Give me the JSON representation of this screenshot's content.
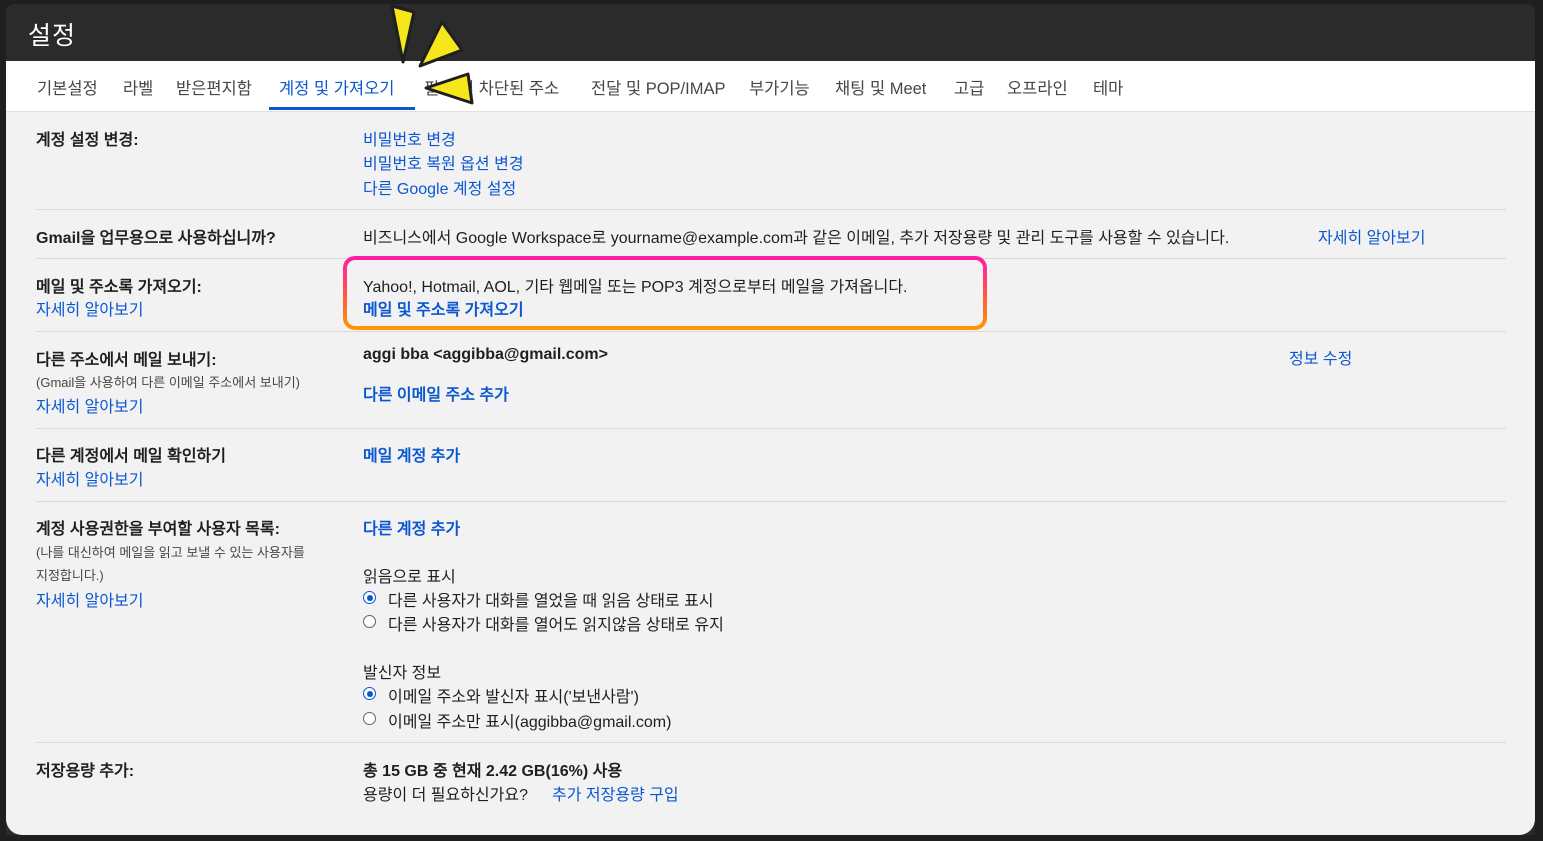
{
  "title": "설정",
  "tabs": [
    {
      "label": "기본설정"
    },
    {
      "label": "라벨"
    },
    {
      "label": "받은편지함"
    },
    {
      "label": "계정 및 가져오기",
      "active": true
    },
    {
      "label": "필터 및 차단된 주소"
    },
    {
      "label": "전달 및 POP/IMAP"
    },
    {
      "label": "부가기능"
    },
    {
      "label": "채팅 및 Meet"
    },
    {
      "label": "고급"
    },
    {
      "label": "오프라인"
    },
    {
      "label": "테마"
    }
  ],
  "sections": {
    "account_change": {
      "label": "계정 설정 변경:",
      "links": [
        "비밀번호 변경",
        "비밀번호 복원 옵션 변경",
        "다른 Google 계정 설정"
      ]
    },
    "business": {
      "label": "Gmail을 업무용으로 사용하십니까?",
      "text": "비즈니스에서 Google Workspace로 yourname@example.com과 같은 이메일, 추가 저장용량 및 관리 도구를 사용할 수 있습니다.",
      "link": "자세히 알아보기"
    },
    "import": {
      "label": "메일 및 주소록 가져오기:",
      "learn_more": "자세히 알아보기",
      "text": "Yahoo!, Hotmail, AOL, 기타 웹메일 또는 POP3 계정으로부터 메일을 가져옵니다.",
      "action": "메일 및 주소록 가져오기"
    },
    "send_as": {
      "label": "다른 주소에서 메일 보내기:",
      "sub": "(Gmail을 사용하여 다른 이메일 주소에서 보내기)",
      "learn_more": "자세히 알아보기",
      "address": "aggi bba <aggibba@gmail.com>",
      "edit": "정보 수정",
      "add": "다른 이메일 주소 추가"
    },
    "check_mail": {
      "label": "다른 계정에서 메일 확인하기",
      "learn_more": "자세히 알아보기",
      "add": "메일 계정 추가"
    },
    "delegate": {
      "label": "계정 사용권한을 부여할 사용자 목록:",
      "sub_line1": "(나를 대신하여 메일을 읽고 보낼 수 있는 사용자를",
      "sub_line2": "지정합니다.)",
      "learn_more": "자세히 알아보기",
      "add": "다른 계정 추가",
      "read_title": "읽음으로 표시",
      "read_options": [
        {
          "label": "다른 사용자가 대화를 열었을 때 읽음 상태로 표시",
          "checked": true
        },
        {
          "label": "다른 사용자가 대화를 열어도 읽지않음 상태로 유지",
          "checked": false
        }
      ],
      "sender_title": "발신자 정보",
      "sender_options": [
        {
          "label": "이메일 주소와 발신자 표시('보낸사람')",
          "checked": true
        },
        {
          "label": "이메일 주소만 표시(aggibba@gmail.com)",
          "checked": false
        }
      ]
    },
    "storage": {
      "label": "저장용량 추가:",
      "usage": "총 15 GB 중 현재 2.42 GB(16%) 사용",
      "question": "용량이 더 필요하신가요?",
      "buy": "추가 저장용량 구입"
    }
  },
  "colors": {
    "accent": "#0b57d0",
    "highlight_top": "#ff1aa8",
    "highlight_bottom": "#ff9a00",
    "arrow": "#f5e71b"
  }
}
